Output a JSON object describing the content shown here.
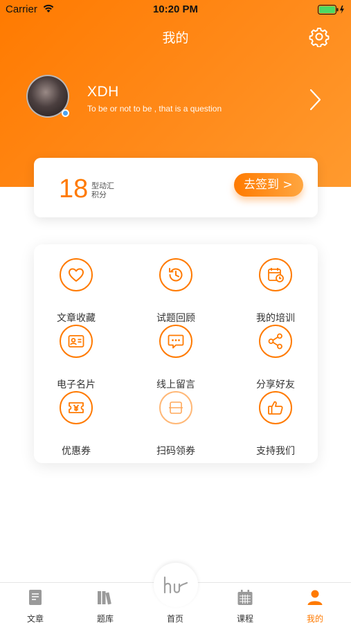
{
  "status_bar": {
    "carrier": "Carrier",
    "time": "10:20 PM"
  },
  "nav": {
    "title": "我的",
    "settings_icon": "gear-icon"
  },
  "profile": {
    "name": "XDH",
    "signature": "To be or not to be , that is a question"
  },
  "points": {
    "value": "18",
    "brand": "型动汇",
    "unit": "积分",
    "checkin_label": "去签到 >"
  },
  "menu": [
    {
      "label": "文章收藏",
      "icon": "heart-icon"
    },
    {
      "label": "试题回顾",
      "icon": "history-clock-icon"
    },
    {
      "label": "我的培训",
      "icon": "calendar-clock-icon"
    },
    {
      "label": "电子名片",
      "icon": "id-card-icon"
    },
    {
      "label": "线上留言",
      "icon": "chat-bubble-icon"
    },
    {
      "label": "分享好友",
      "icon": "share-icon"
    },
    {
      "label": "优惠券",
      "icon": "yen-coupon-icon"
    },
    {
      "label": "扫码领券",
      "icon": "scan-icon"
    },
    {
      "label": "支持我们",
      "icon": "thumbs-up-icon"
    }
  ],
  "tabs": [
    {
      "label": "文章",
      "icon": "document-icon"
    },
    {
      "label": "题库",
      "icon": "books-icon"
    },
    {
      "label": "首页",
      "icon": "home-logo-icon"
    },
    {
      "label": "课程",
      "icon": "calendar-icon"
    },
    {
      "label": "我的",
      "icon": "person-icon",
      "active": true
    }
  ],
  "colors": {
    "accent": "#ff7a00",
    "accent_light": "#ffa640",
    "tab_inactive": "#9a9a9a"
  }
}
